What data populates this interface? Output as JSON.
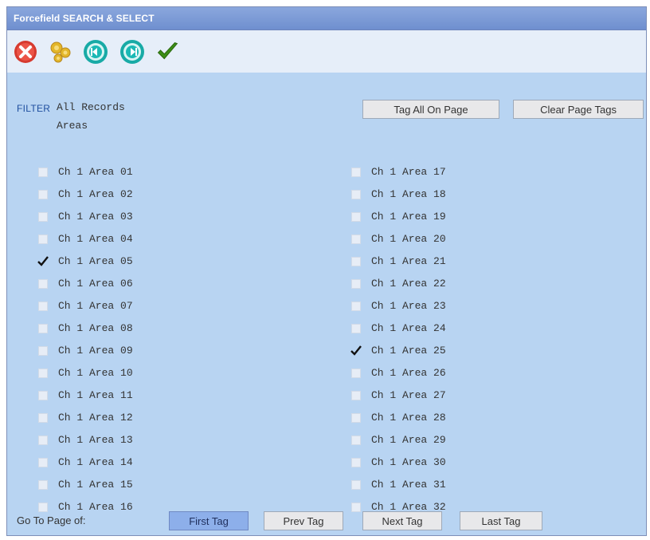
{
  "window": {
    "title": "Forcefield SEARCH & SELECT"
  },
  "toolbar": {
    "icons": [
      {
        "name": "close-icon",
        "color": "#e3473d"
      },
      {
        "name": "settings-gears-icon",
        "color": "#f1c84b"
      },
      {
        "name": "previous-icon",
        "color": "#21b5b1"
      },
      {
        "name": "next-icon",
        "color": "#21b5b1"
      },
      {
        "name": "confirm-check-icon",
        "color": "#4f9f1a"
      }
    ]
  },
  "filter": {
    "label": "FILTER",
    "value": "All Records",
    "subvalue": "Areas"
  },
  "actions": {
    "tag_all": "Tag All On Page",
    "clear_page": "Clear Page Tags"
  },
  "areas": [
    {
      "label": "Ch 1 Area 01",
      "checked": false
    },
    {
      "label": "Ch 1 Area 02",
      "checked": false
    },
    {
      "label": "Ch 1 Area 03",
      "checked": false
    },
    {
      "label": "Ch 1 Area 04",
      "checked": false
    },
    {
      "label": "Ch 1 Area 05",
      "checked": true
    },
    {
      "label": "Ch 1 Area 06",
      "checked": false
    },
    {
      "label": "Ch 1 Area 07",
      "checked": false
    },
    {
      "label": "Ch 1 Area 08",
      "checked": false
    },
    {
      "label": "Ch 1 Area 09",
      "checked": false
    },
    {
      "label": "Ch 1 Area 10",
      "checked": false
    },
    {
      "label": "Ch 1 Area 11",
      "checked": false
    },
    {
      "label": "Ch 1 Area 12",
      "checked": false
    },
    {
      "label": "Ch 1 Area 13",
      "checked": false
    },
    {
      "label": "Ch 1 Area 14",
      "checked": false
    },
    {
      "label": "Ch 1 Area 15",
      "checked": false
    },
    {
      "label": "Ch 1 Area 16",
      "checked": false
    },
    {
      "label": "Ch 1 Area 17",
      "checked": false
    },
    {
      "label": "Ch 1 Area 18",
      "checked": false
    },
    {
      "label": "Ch 1 Area 19",
      "checked": false
    },
    {
      "label": "Ch 1 Area 20",
      "checked": false
    },
    {
      "label": "Ch 1 Area 21",
      "checked": false
    },
    {
      "label": "Ch 1 Area 22",
      "checked": false
    },
    {
      "label": "Ch 1 Area 23",
      "checked": false
    },
    {
      "label": "Ch 1 Area 24",
      "checked": false
    },
    {
      "label": "Ch 1 Area 25",
      "checked": true
    },
    {
      "label": "Ch 1 Area 26",
      "checked": false
    },
    {
      "label": "Ch 1 Area 27",
      "checked": false
    },
    {
      "label": "Ch 1 Area 28",
      "checked": false
    },
    {
      "label": "Ch 1 Area 29",
      "checked": false
    },
    {
      "label": "Ch 1 Area 30",
      "checked": false
    },
    {
      "label": "Ch 1 Area 31",
      "checked": false
    },
    {
      "label": "Ch 1 Area 32",
      "checked": false
    }
  ],
  "pager": {
    "label": "Go To Page of:",
    "first": "First Tag",
    "prev": "Prev Tag",
    "next": "Next Tag",
    "last": "Last Tag"
  }
}
